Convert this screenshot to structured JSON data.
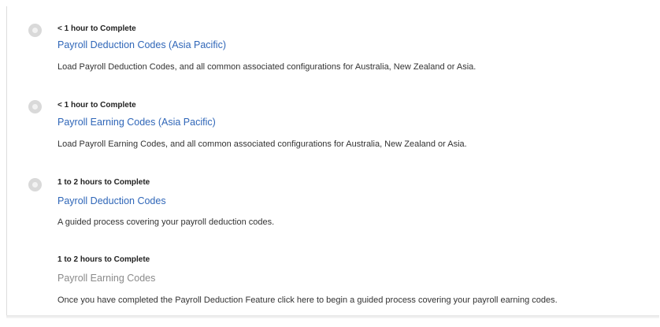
{
  "tasks": [
    {
      "duration": "< 1 hour to Complete",
      "title": "Payroll Deduction Codes (Asia Pacific)",
      "description": "Load Payroll Deduction Codes, and all common associated configurations for Australia, New Zealand or Asia.",
      "status_icon": "circle-status-icon",
      "enabled": true
    },
    {
      "duration": "< 1 hour to Complete",
      "title": "Payroll Earning Codes (Asia Pacific)",
      "description": "Load Payroll Earning Codes, and all common associated configurations for Australia, New Zealand or Asia.",
      "status_icon": "circle-status-icon",
      "enabled": true
    },
    {
      "duration": "1 to 2 hours to Complete",
      "title": "Payroll Deduction Codes",
      "description": "A guided process covering your payroll deduction codes.",
      "status_icon": "circle-status-icon",
      "enabled": true
    },
    {
      "duration": "1 to 2 hours to Complete",
      "title": "Payroll Earning Codes",
      "description": "Once you have completed the Payroll Deduction Feature click here to begin a guided process covering your payroll earning codes.",
      "enabled": false
    }
  ],
  "colors": {
    "link": "#2f66b8",
    "link_disabled": "#8a8a8a",
    "status_dot": "#d9d9d9"
  }
}
